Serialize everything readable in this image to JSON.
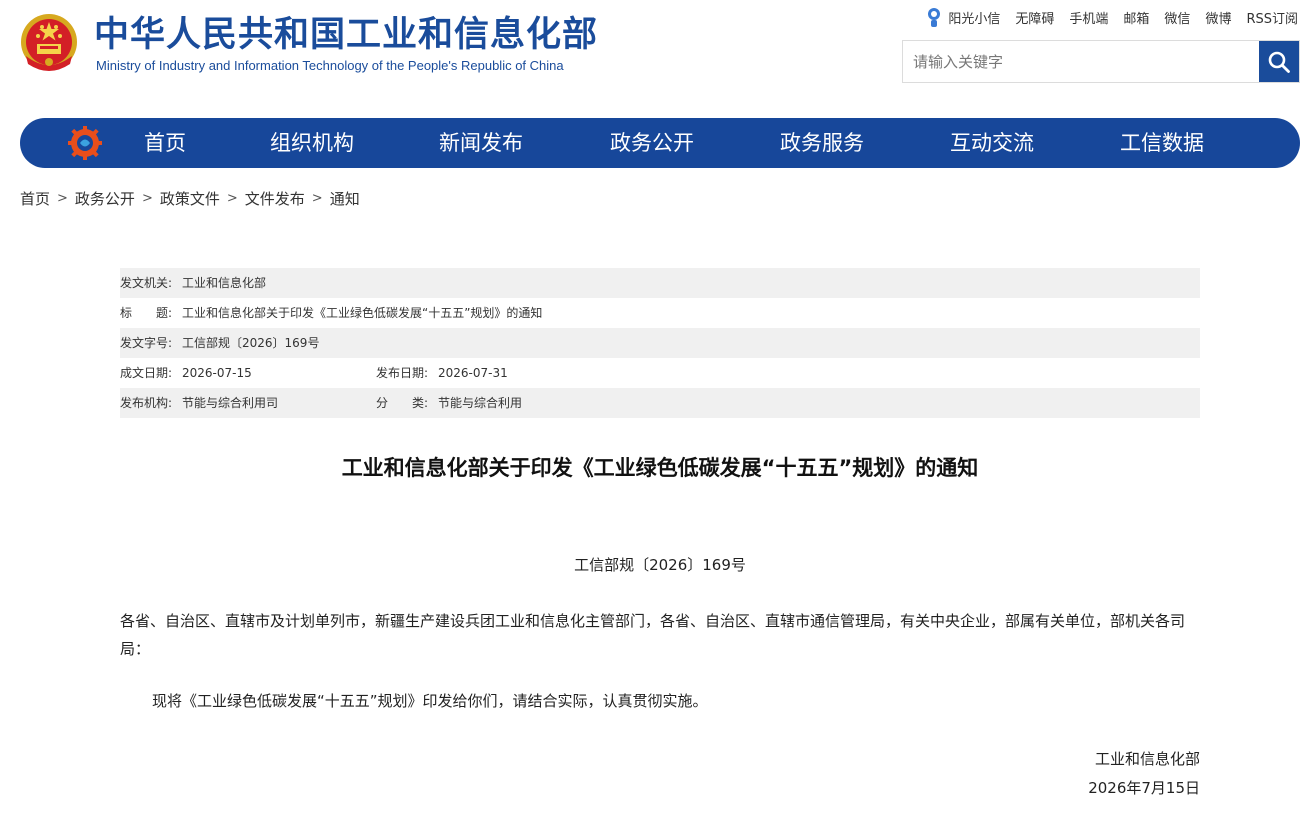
{
  "header": {
    "title_cn": "中华人民共和国工业和信息化部",
    "title_en": "Ministry of Industry and Information Technology of the People's Republic of China",
    "top_links": [
      "阳光小信",
      "无障碍",
      "手机端",
      "邮箱",
      "微信",
      "微博",
      "RSS订阅"
    ],
    "search_placeholder": "请输入关键字"
  },
  "nav": {
    "items": [
      "首页",
      "组织机构",
      "新闻发布",
      "政务公开",
      "政务服务",
      "互动交流",
      "工信数据"
    ]
  },
  "breadcrumb": [
    "首页",
    "政务公开",
    "政策文件",
    "文件发布",
    "通知"
  ],
  "breadcrumb_sep": ">",
  "meta": {
    "issuer_label": "发文机关:",
    "issuer": "工业和信息化部",
    "title_label": "标　　题:",
    "title": "工业和信息化部关于印发《工业绿色低碳发展“十五五”规划》的通知",
    "doc_no_label": "发文字号:",
    "doc_no": "工信部规〔2026〕169号",
    "created_label": "成文日期:",
    "created": "2026-07-15",
    "published_label": "发布日期:",
    "published": "2026-07-31",
    "agency_label": "发布机构:",
    "agency": "节能与综合利用司",
    "category_label": "分　　类:",
    "category": "节能与综合利用"
  },
  "article": {
    "title": "工业和信息化部关于印发《工业绿色低碳发展“十五五”规划》的通知",
    "doc_number": "工信部规〔2026〕169号",
    "recipients": "各省、自治区、直辖市及计划单列市，新疆生产建设兵团工业和信息化主管部门，各省、自治区、直辖市通信管理局，有关中央企业，部属有关单位，部机关各司局：",
    "body": "现将《工业绿色低碳发展“十五五”规划》印发给你们，请结合实际，认真贯彻实施。",
    "signature_org": "工业和信息化部",
    "signature_date": "2026年7月15日"
  },
  "colors": {
    "brand_blue": "#1a4c9b",
    "nav_blue": "#17479a",
    "meta_shade": "#f0f0f0"
  }
}
